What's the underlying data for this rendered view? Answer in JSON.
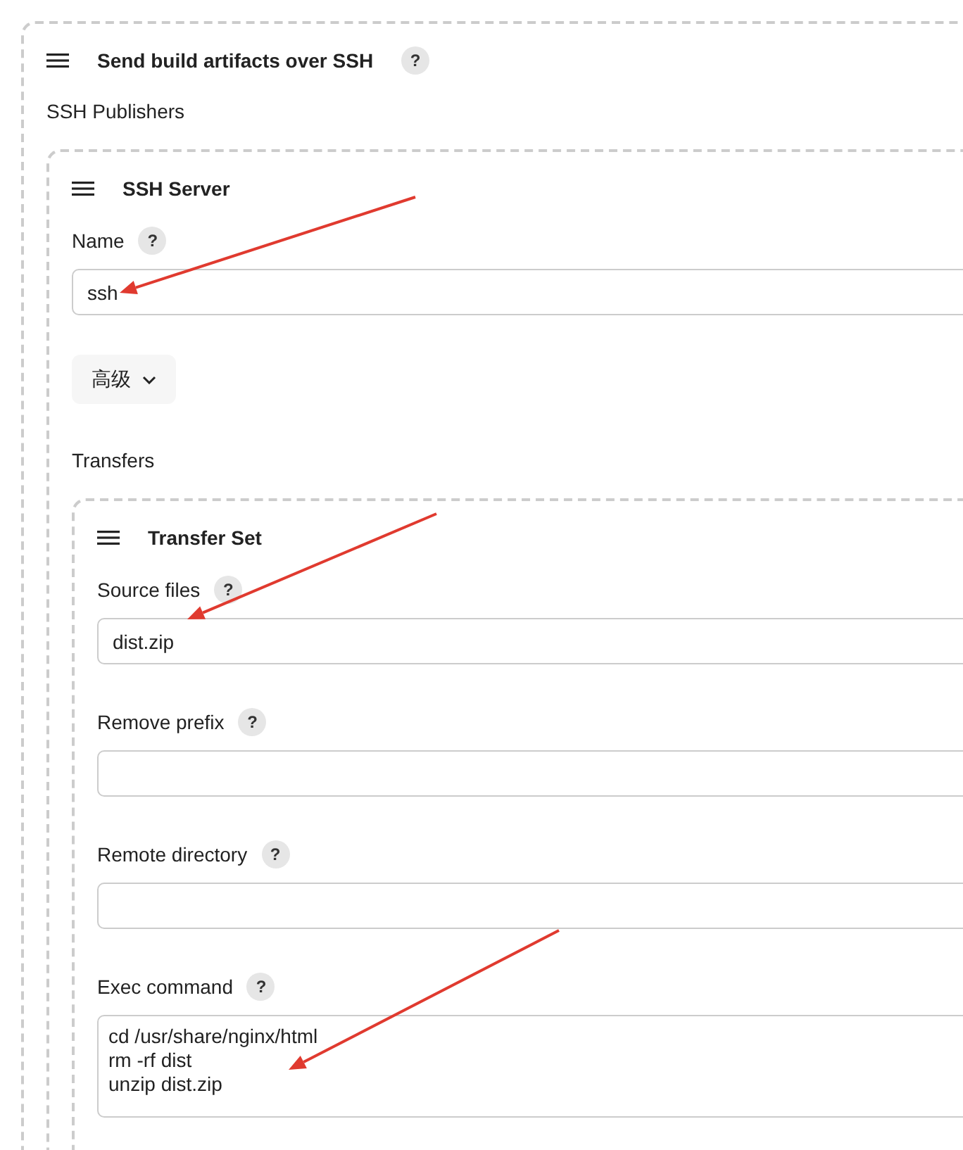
{
  "section": {
    "title": "Send build artifacts over SSH",
    "help": "?"
  },
  "publishers_label": "SSH Publishers",
  "server": {
    "title": "SSH Server",
    "fields": [
      {
        "label": "Name",
        "help": "?",
        "value": "ssh",
        "kind": "input"
      }
    ],
    "advanced_button": "高级",
    "transfers_label": "Transfers",
    "transfer_set": {
      "title": "Transfer Set",
      "fields": [
        {
          "label": "Source files",
          "help": "?",
          "value": "dist.zip",
          "kind": "input"
        },
        {
          "label": "Remove prefix",
          "help": "?",
          "kind": "input"
        },
        {
          "label": "Remote directory",
          "help": "?",
          "kind": "input"
        },
        {
          "label": "Exec command",
          "help": "?",
          "value": "cd /usr/share/nginx/html\nrm -rf dist\nunzip dist.zip",
          "kind": "textarea"
        }
      ]
    }
  }
}
